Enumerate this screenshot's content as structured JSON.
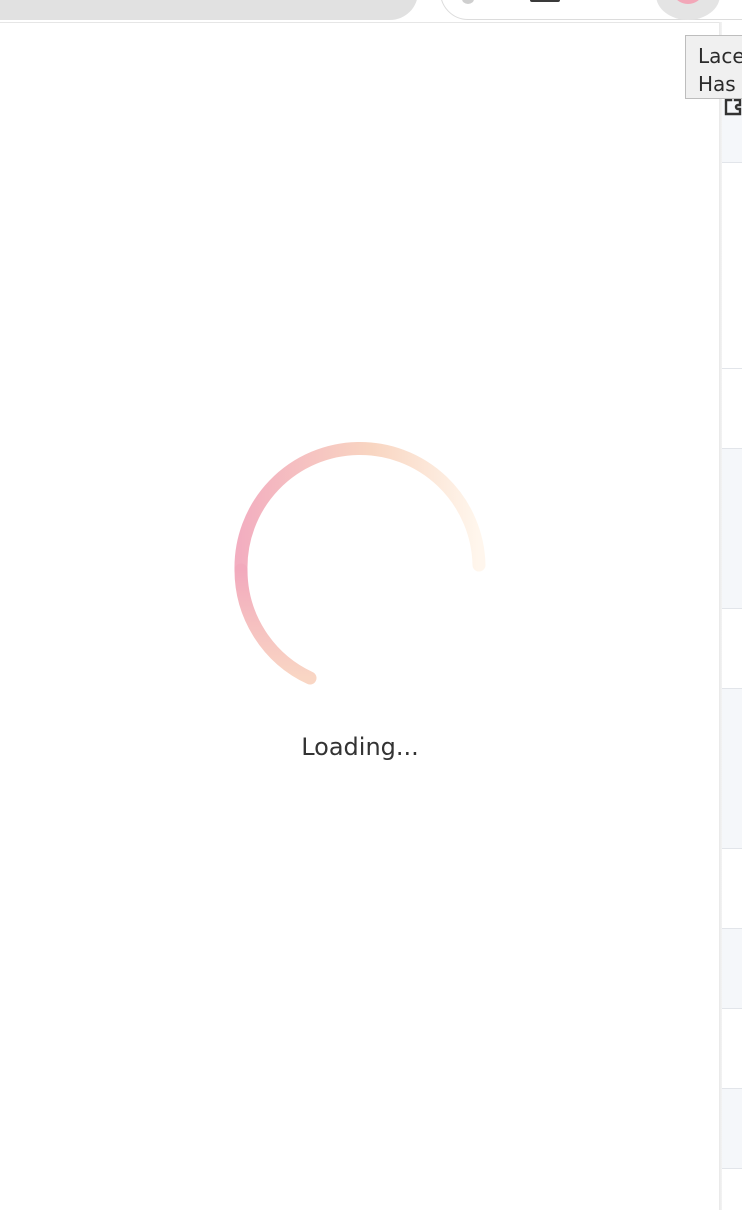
{
  "tooltip": {
    "line1": "Lace",
    "line2": "Has"
  },
  "loader": {
    "text": "Loading...",
    "icon": "spinner-icon",
    "colors": {
      "pink": "#f2aabd",
      "peach": "#f8d3be",
      "cream": "#fbecd9"
    }
  },
  "background_page": {
    "icon": "puzzle-icon"
  }
}
